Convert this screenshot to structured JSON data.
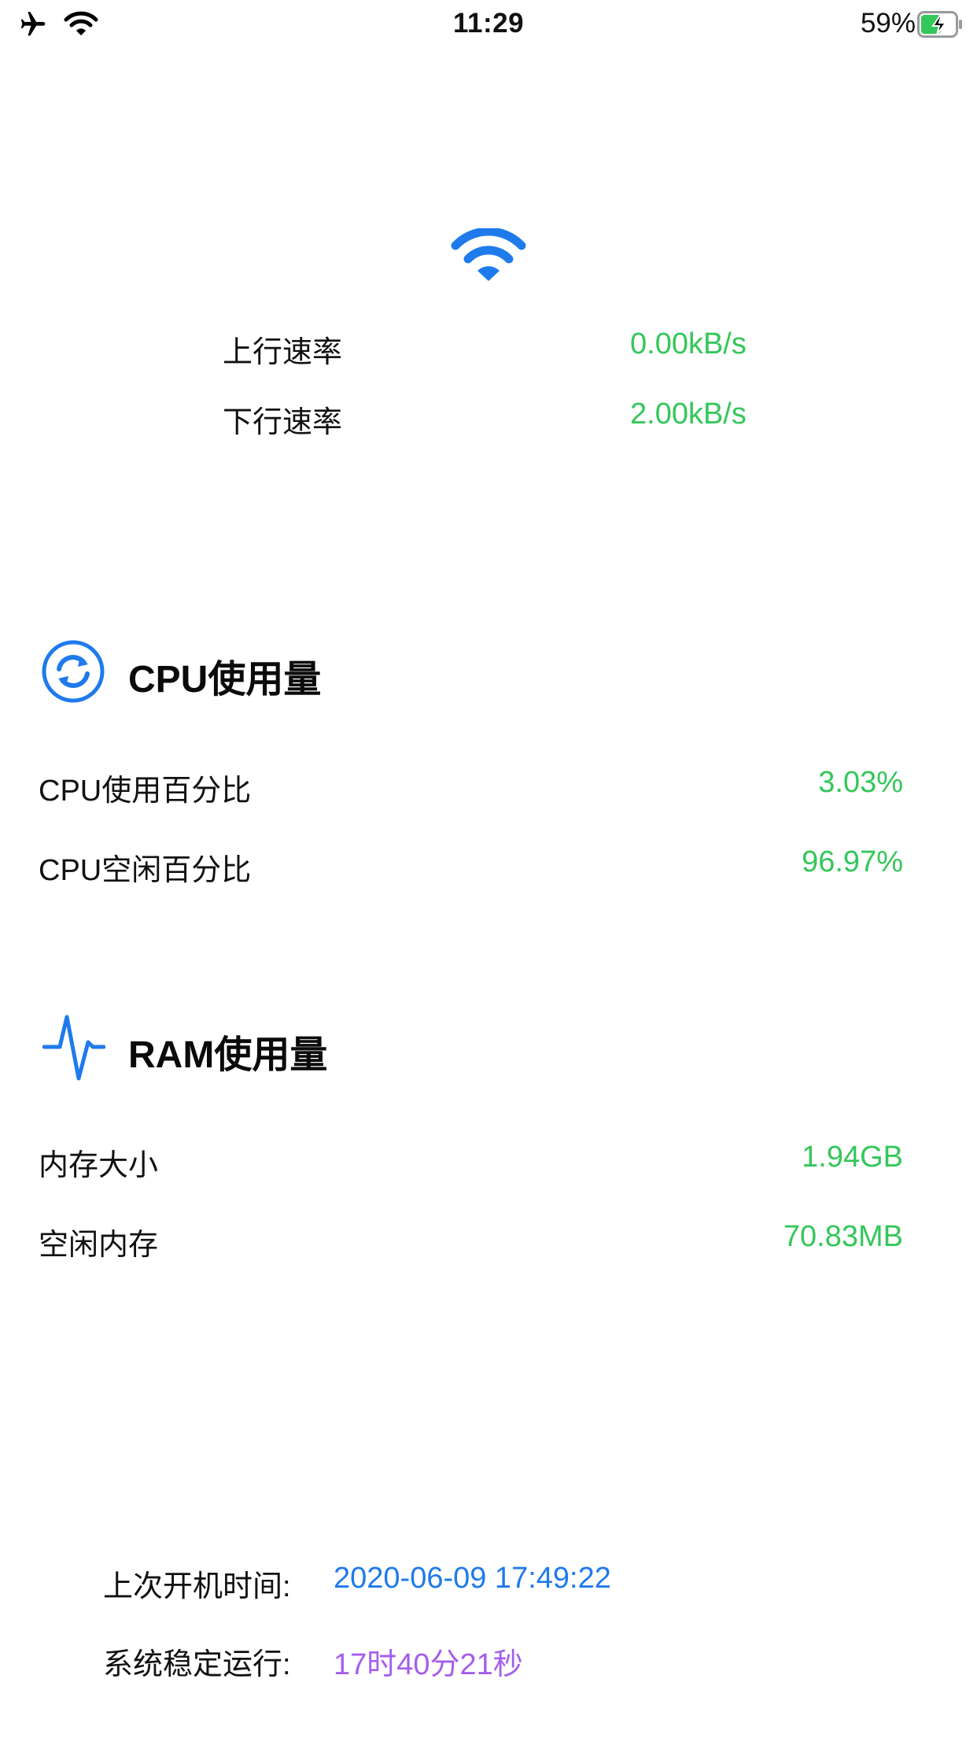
{
  "status_bar": {
    "time": "11:29",
    "battery_percent": "59%",
    "battery_level": 0.59,
    "icons": [
      "airplane-icon",
      "wifi-icon",
      "battery-charging-icon"
    ]
  },
  "network": {
    "icon": "wifi-icon",
    "upload_label": "上行速率",
    "upload_value": "0.00kB/s",
    "download_label": "下行速率",
    "download_value": "2.00kB/s"
  },
  "cpu": {
    "icon": "refresh-circle-icon",
    "title": "CPU使用量",
    "rows": [
      {
        "label": "CPU使用百分比",
        "value": "3.03%"
      },
      {
        "label": "CPU空闲百分比",
        "value": "96.97%"
      }
    ]
  },
  "ram": {
    "icon": "pulse-icon",
    "title": "RAM使用量",
    "rows": [
      {
        "label": "内存大小",
        "value": "1.94GB"
      },
      {
        "label": "空闲内存",
        "value": "70.83MB"
      }
    ]
  },
  "footer": {
    "boot_label": "上次开机时间:",
    "boot_value": "2020-06-09 17:49:22",
    "uptime_label": "系统稳定运行:",
    "uptime_value": "17时40分21秒"
  },
  "colors": {
    "accent_blue": "#1f7aec",
    "value_green": "#34c759",
    "uptime_purple": "#a55eea",
    "battery_green": "#34c759"
  }
}
